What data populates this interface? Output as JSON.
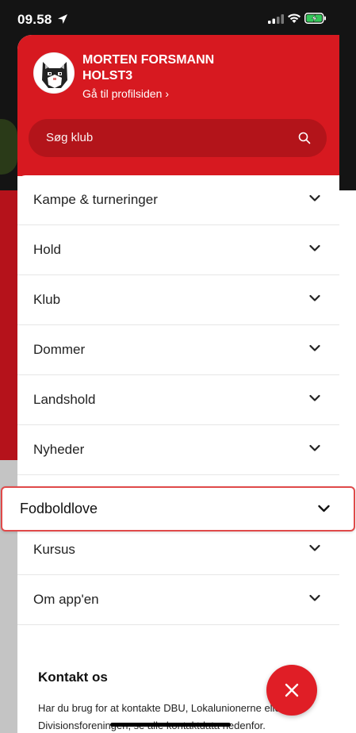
{
  "status_bar": {
    "time": "09.58"
  },
  "profile": {
    "name": "MORTEN FORSMANN HOLST3",
    "link_label": "Gå til profilsiden",
    "link_chevron": "›"
  },
  "search": {
    "placeholder": "Søg klub"
  },
  "menu": {
    "items": [
      {
        "label": "Kampe & turneringer"
      },
      {
        "label": "Hold"
      },
      {
        "label": "Klub"
      },
      {
        "label": "Dommer"
      },
      {
        "label": "Landshold"
      },
      {
        "label": "Nyheder"
      },
      {
        "label": "Fodboldlove"
      },
      {
        "label": "Kursus"
      },
      {
        "label": "Om app'en"
      }
    ]
  },
  "contact": {
    "title": "Kontakt os",
    "text": "Har du brug for at kontakte DBU, Lokalunionerne eller Divisionsforeningen, se alle kontaktdata nedenfor."
  },
  "colors": {
    "brand_red": "#d71920",
    "search_bg": "#b3141a",
    "highlight_border": "#e04a4a"
  },
  "icons": {
    "location": "location-arrow-icon",
    "signal": "signal-icon",
    "wifi": "wifi-icon",
    "battery": "battery-charging-icon",
    "search": "search-icon",
    "chevron": "chevron-down-icon",
    "close": "close-icon",
    "avatar": "cat-avatar-icon"
  }
}
